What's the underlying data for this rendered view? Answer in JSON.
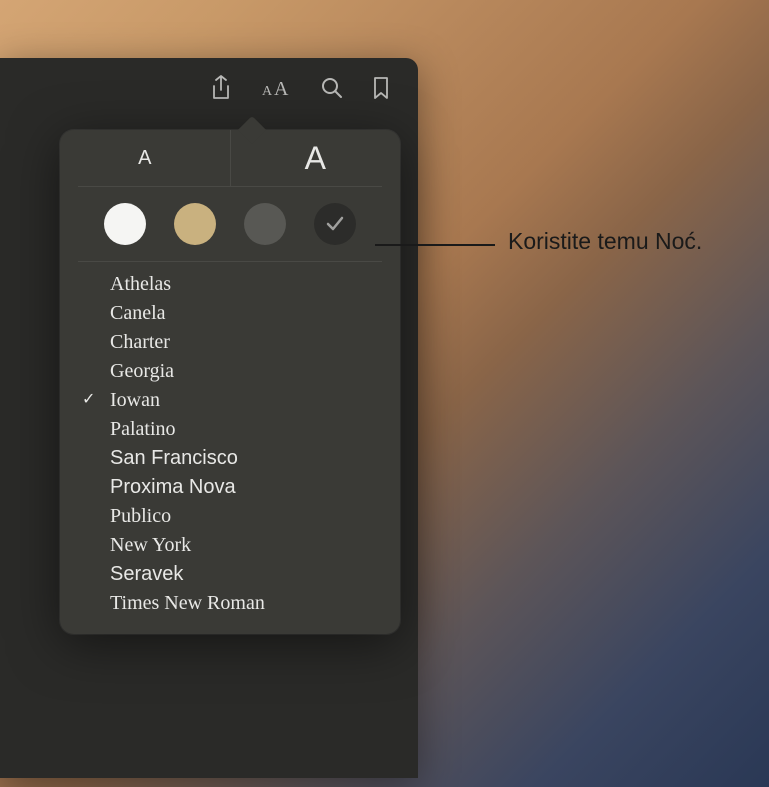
{
  "toolbar": {
    "share_icon": "share-icon",
    "appearance_icon": "appearance-icon",
    "search_icon": "search-icon",
    "bookmark_icon": "bookmark-icon"
  },
  "popover": {
    "font_size_small": "A",
    "font_size_large": "A",
    "themes": [
      {
        "name": "white",
        "color": "#f5f5f3",
        "selected": false
      },
      {
        "name": "sepia",
        "color": "#c9b17f",
        "selected": false
      },
      {
        "name": "gray",
        "color": "#585854",
        "selected": false
      },
      {
        "name": "night",
        "color": "#2c2c2a",
        "selected": true
      }
    ],
    "fonts": [
      {
        "label": "Athelas",
        "class": "font-athelas",
        "selected": false
      },
      {
        "label": "Canela",
        "class": "font-canela",
        "selected": false
      },
      {
        "label": "Charter",
        "class": "font-charter",
        "selected": false
      },
      {
        "label": "Georgia",
        "class": "font-georgia",
        "selected": false
      },
      {
        "label": "Iowan",
        "class": "font-iowan",
        "selected": true
      },
      {
        "label": "Palatino",
        "class": "font-palatino",
        "selected": false
      },
      {
        "label": "San Francisco",
        "class": "font-sanfrancisco",
        "selected": false
      },
      {
        "label": "Proxima Nova",
        "class": "font-proxima",
        "selected": false
      },
      {
        "label": "Publico",
        "class": "font-publico",
        "selected": false
      },
      {
        "label": "New York",
        "class": "font-newyork",
        "selected": false
      },
      {
        "label": "Seravek",
        "class": "font-seravek",
        "selected": false
      },
      {
        "label": "Times New Roman",
        "class": "font-times",
        "selected": false
      }
    ]
  },
  "callout": {
    "text": "Koristite temu Noć."
  }
}
